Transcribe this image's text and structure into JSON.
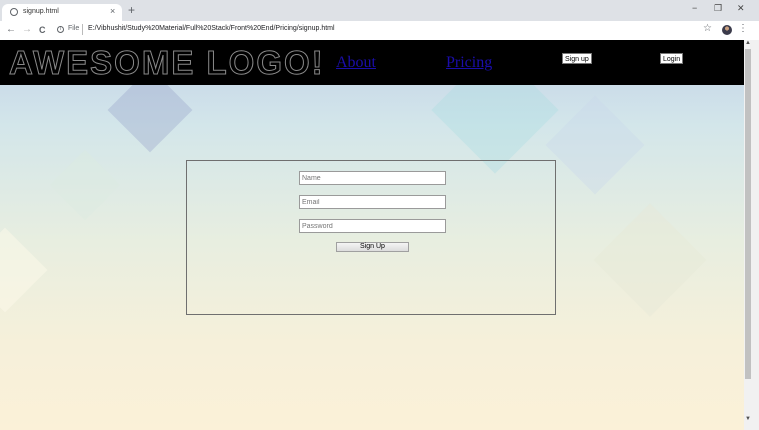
{
  "browser": {
    "tab_title": "signup.html",
    "tab_close": "×",
    "new_tab": "+",
    "minimize": "−",
    "restore": "❐",
    "close": "✕",
    "back": "←",
    "forward": "→",
    "reload": "C",
    "info": "i",
    "file_label": "File",
    "url": "E:/Vibhushit/Study%20Material/Full%20Stack/Front%20End/Pricing/signup.html",
    "star": "☆",
    "menu": "⋮"
  },
  "header": {
    "logo": "AWESOME LOGO!",
    "nav": [
      "About",
      "Pricing"
    ],
    "signup_label": "Sign up",
    "login_label": "Login"
  },
  "form": {
    "name_placeholder": "Name",
    "email_placeholder": "Email",
    "password_placeholder": "Password",
    "submit_label": "Sign Up"
  },
  "scrollbar": {
    "up": "▲",
    "down": "▼"
  },
  "colors": {
    "link": "#1a0dab",
    "header_bg": "#000000"
  }
}
